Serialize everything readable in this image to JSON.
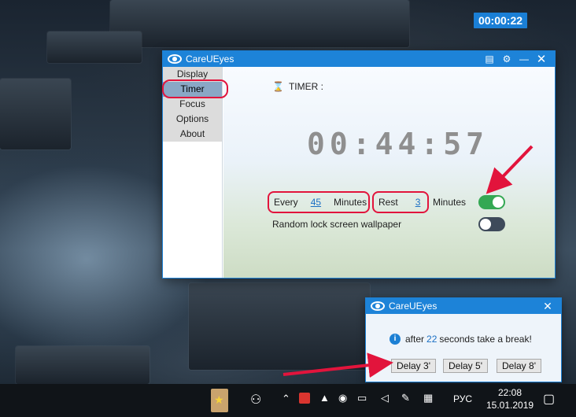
{
  "desktop": {
    "timer_badge": "00:00:22"
  },
  "main_window": {
    "title": "CareUEyes",
    "nav": [
      {
        "label": "Display",
        "active": false
      },
      {
        "label": "Timer",
        "active": true
      },
      {
        "label": "Focus",
        "active": false
      },
      {
        "label": "Options",
        "active": false
      },
      {
        "label": "About",
        "active": false
      }
    ],
    "timer_heading": "TIMER :",
    "countdown": "00:44:57",
    "every_label": "Every",
    "every_value": "45",
    "minutes_label_1": "Minutes",
    "rest_label": "Rest",
    "rest_value": "3",
    "minutes_label_2": "Minutes",
    "random_wallpaper_label": "Random lock screen wallpaper",
    "timer_toggle_on": true,
    "wallpaper_toggle_on": false
  },
  "popup": {
    "title": "CareUEyes",
    "message_prefix": "after",
    "seconds_value": "22",
    "message_suffix": "seconds take a break!",
    "buttons": [
      "Delay 3'",
      "Delay 5'",
      "Delay 8'"
    ]
  },
  "taskbar": {
    "language": "РУС",
    "time": "22:08",
    "date": "15.01.2019"
  },
  "colors": {
    "accent": "#1d83d8",
    "highlight_red": "#e2143c",
    "toggle_on": "#34a853"
  }
}
